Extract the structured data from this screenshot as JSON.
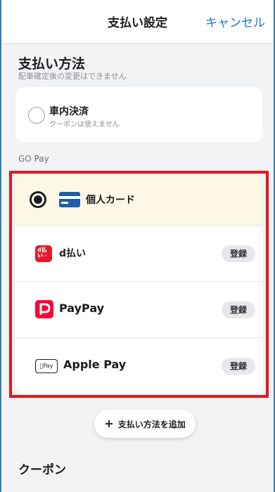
{
  "header": {
    "title": "支払い設定",
    "cancel_label": "キャンセル"
  },
  "payment_method": {
    "title": "支払い方法",
    "note": "配車確定後の変更はできません",
    "in_car": {
      "label": "車内決済",
      "sub": "クーポンは使えません",
      "selected": false
    }
  },
  "gopay": {
    "section_label": "GO Pay",
    "options": [
      {
        "label": "個人カード",
        "selected": true,
        "icon": "credit-card-icon"
      },
      {
        "label": "d払い",
        "register_label": "登録",
        "icon": "d-barai-icon",
        "icon_text": "d払い"
      },
      {
        "label": "PayPay",
        "register_label": "登録",
        "icon": "paypay-icon"
      },
      {
        "label": "Apple Pay",
        "register_label": "登録",
        "icon": "apple-pay-icon",
        "icon_text": "Pay"
      }
    ]
  },
  "add_method": {
    "plus": "+",
    "label": "支払い方法を追加"
  },
  "coupon": {
    "title": "クーポン"
  },
  "colors": {
    "accent_blue": "#1a73e8",
    "highlight_red": "#e5171b",
    "selected_row_bg": "#fdf8e6"
  }
}
